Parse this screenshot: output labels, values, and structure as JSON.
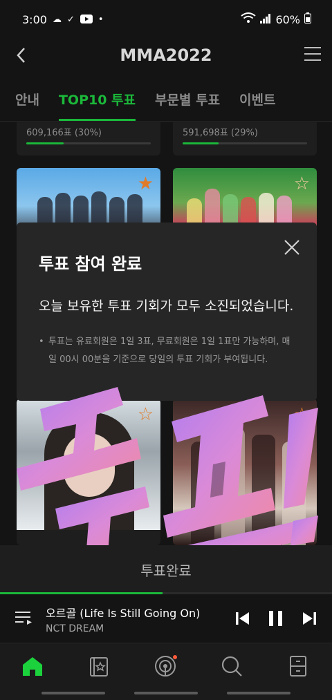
{
  "status_bar": {
    "time": "3:00",
    "battery": "60%",
    "left_icons": [
      "weather-icon",
      "check-icon",
      "youtube-icon",
      "dot-icon"
    ],
    "right_icons": [
      "wifi-icon",
      "signal-icon",
      "battery-icon"
    ]
  },
  "header": {
    "title": "MMA2022"
  },
  "tabs": [
    {
      "label": "안내",
      "active": false
    },
    {
      "label": "TOP10 투표",
      "active": true
    },
    {
      "label": "부문별 투표",
      "active": false
    },
    {
      "label": "이벤트",
      "active": false
    }
  ],
  "vote_cards": [
    {
      "votes": "609,166표 (30%)",
      "share": 0.3
    },
    {
      "votes": "591,698표 (29%)",
      "share": 0.29
    }
  ],
  "artist_cards": [
    {
      "name": "",
      "icon": "star-icon"
    },
    {
      "name": "",
      "icon": "star-icon"
    },
    {
      "name": "",
      "icon": "star-icon"
    },
    {
      "name": "",
      "icon": "star-icon"
    }
  ],
  "modal": {
    "title": "투표 참여 완료",
    "message": "오늘 보유한 투표 기회가 모두 소진되었습니다.",
    "note": "투표는 유료회원은 1일 3표, 무료회원은 1일 1표만 가능하며, 매일 00시 00분을 기준으로 당일의 투표 기회가 부여됩니다."
  },
  "sticker": {
    "text": "투표!"
  },
  "done_bar": {
    "label": "투표완료"
  },
  "player": {
    "track_title": "오르골 (Life Is Still Going On)",
    "artist": "NCT DREAM",
    "progress": 0.49
  },
  "bottom_nav": [
    {
      "name": "home",
      "active": true
    },
    {
      "name": "library",
      "active": false
    },
    {
      "name": "podcast",
      "active": false,
      "badge": true
    },
    {
      "name": "search",
      "active": false
    },
    {
      "name": "storage",
      "active": false
    }
  ],
  "colors": {
    "accent": "#1bb83a",
    "background": "#141414",
    "modal": "#262626",
    "sticker_purple": "#b07cf0",
    "sticker_pink": "#f08aa6"
  }
}
